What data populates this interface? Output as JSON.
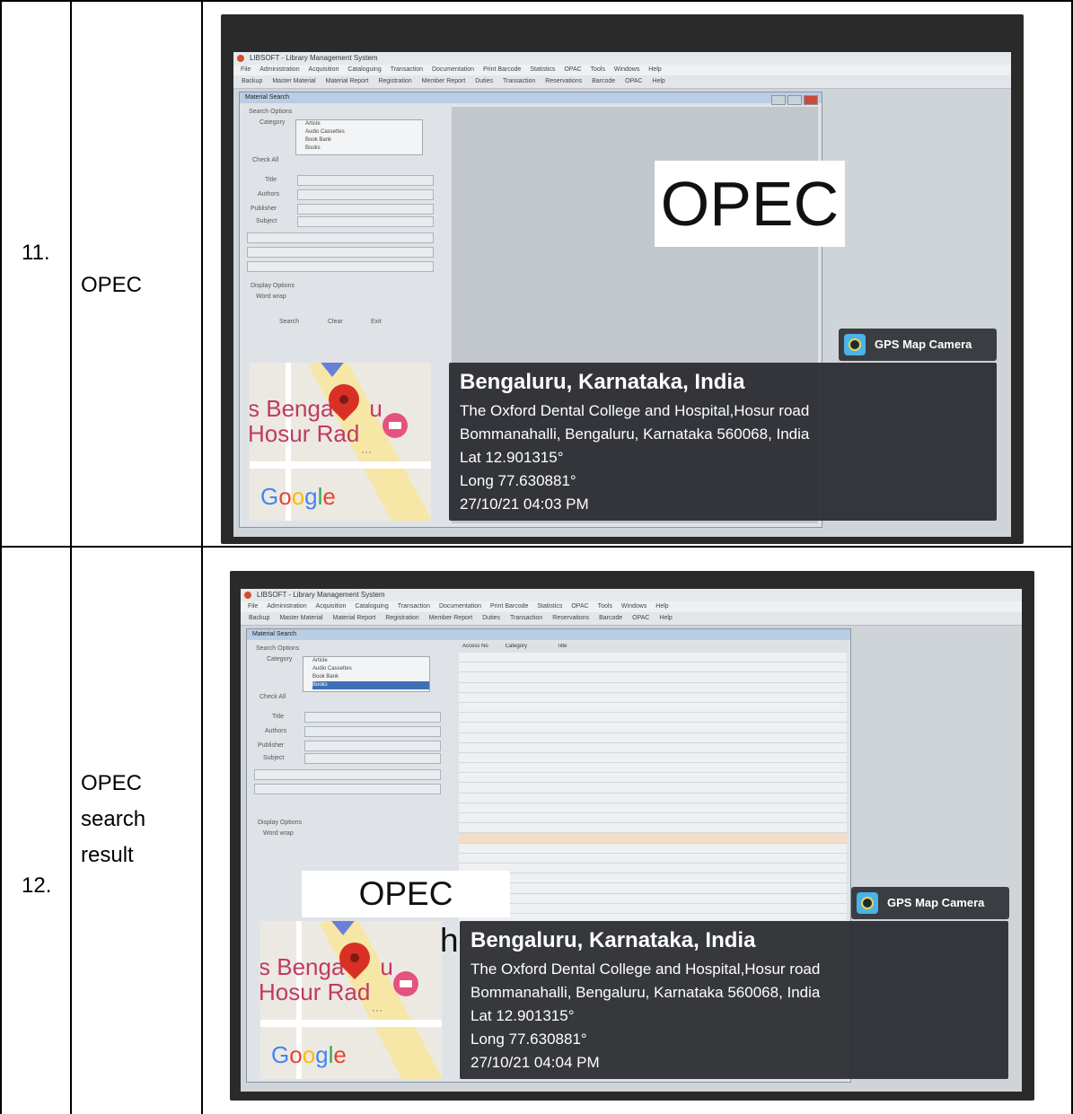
{
  "rows": [
    {
      "number": "11.",
      "description": "OPEC",
      "photo": {
        "overlay_label": "OPEC",
        "gps_badge": "GPS Map Camera",
        "location": {
          "city": "Bengaluru, Karnataka, India",
          "address_line1": "The Oxford Dental College and Hospital,Hosur road",
          "address_line2": "Bommanahalli, Bengaluru, Karnataka 560068, India",
          "lat": "Lat 12.901315°",
          "long": "Long 77.630881°",
          "datetime": "27/10/21 04:03 PM"
        },
        "map": {
          "label1": "s Benga",
          "label1b": "u",
          "label2": "Hosur R",
          "label2b": "ad"
        }
      }
    },
    {
      "number": "12.",
      "description_lines": [
        "OPEC",
        "search",
        "result"
      ],
      "photo": {
        "overlay_label": "OPEC Search",
        "gps_badge": "GPS Map Camera",
        "location": {
          "city": "Bengaluru, Karnataka, India",
          "address_line1": "The Oxford Dental College and Hospital,Hosur road",
          "address_line2": "Bommanahalli, Bengaluru, Karnataka 560068, India",
          "lat": "Lat 12.901315°",
          "long": "Long 77.630881°",
          "datetime": "27/10/21 04:04 PM"
        },
        "map": {
          "label1": "s Benga",
          "label1b": "u",
          "label2": "Hosur R",
          "label2b": "ad"
        }
      }
    }
  ],
  "screen": {
    "app_title": "LIBSOFT - Library Management System",
    "menu": [
      "File",
      "Administration",
      "Acquisition",
      "Cataloguing",
      "Transaction",
      "Documentation",
      "Print Barcode",
      "Statistics",
      "OPAC",
      "Tools",
      "Windows",
      "Help"
    ],
    "toolbar": [
      "Backup",
      "Master Material",
      "Material Report",
      "Registration",
      "Member Report",
      "Duties",
      "Transaction",
      "Reservations",
      "Barcode",
      "OPAC",
      "Help"
    ],
    "window_title": "Material Search",
    "search_options_label": "Search Options",
    "category_label": "Category",
    "category_items": [
      "Article",
      "Audio Cassettes",
      "Book Bank",
      "Books"
    ],
    "check_all": "Check All",
    "title_label": "Title",
    "authors_label": "Authors",
    "publisher_label": "Publisher",
    "subject_label": "Subject",
    "display_options": "Display Options",
    "word_wrap": "Word wrap",
    "search_btn": "Search",
    "clear_btn": "Clear",
    "exit_btn": "Exit",
    "grid_headers": [
      "Access No",
      "Category",
      "Title"
    ]
  },
  "colors": {
    "border": "#000000",
    "overlay_bg": "#ffffff",
    "info_bg": "#2a2c30",
    "pin": "#d93025",
    "map_text": "#c03a63"
  }
}
